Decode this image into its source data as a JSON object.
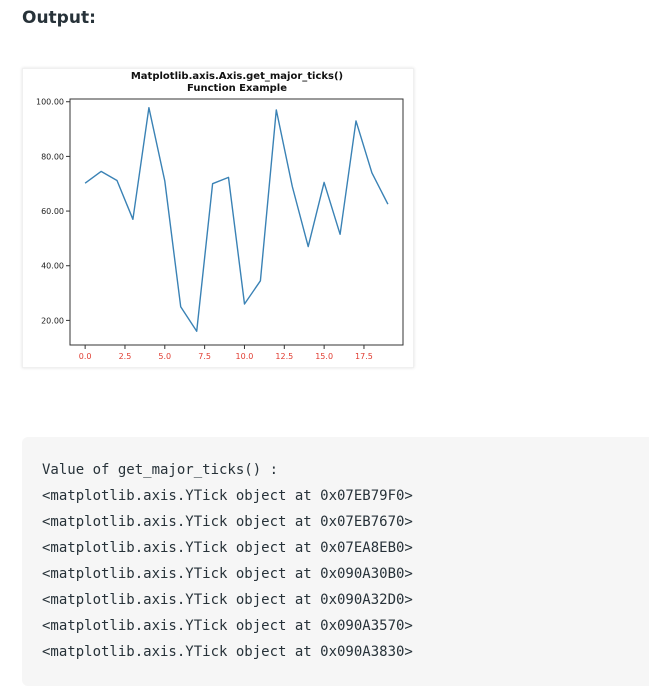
{
  "heading": "Output:",
  "colors": {
    "line": "#3a82b5",
    "xtick_label": "#e03c31",
    "ytick_label": "#222222",
    "axes_frame": "#333333"
  },
  "chart_data": {
    "type": "line",
    "title": "Matplotlib.axis.Axis.get_major_ticks()\nFunction Example",
    "title_lines": [
      "Matplotlib.axis.Axis.get_major_ticks()",
      "Function Example"
    ],
    "xlabel": "",
    "ylabel": "",
    "x": [
      0,
      1,
      2,
      3,
      4,
      5,
      6,
      7,
      8,
      9,
      10,
      11,
      12,
      13,
      14,
      15,
      16,
      17,
      18,
      19
    ],
    "series": [
      {
        "values": [
          70.2,
          74.5,
          71.2,
          57.0,
          97.8,
          71.0,
          25.0,
          16.0,
          70.0,
          72.3,
          26.0,
          34.5,
          97.0,
          69.0,
          47.0,
          70.5,
          51.5,
          93.0,
          74.0,
          62.5
        ]
      }
    ],
    "xlim": [
      -0.95,
      19.95
    ],
    "ylim": [
      11.0,
      101.0
    ],
    "xticks": [
      0.0,
      2.5,
      5.0,
      7.5,
      10.0,
      12.5,
      15.0,
      17.5
    ],
    "xtick_labels": [
      "0.0",
      "2.5",
      "5.0",
      "7.5",
      "10.0",
      "12.5",
      "15.0",
      "17.5"
    ],
    "yticks": [
      20,
      40,
      60,
      80,
      100
    ],
    "ytick_labels": [
      "20.00",
      "40.00",
      "60.00",
      "80.00",
      "100.00"
    ],
    "grid": false
  },
  "output": {
    "lines": [
      "Value of get_major_ticks() :",
      "<matplotlib.axis.YTick object at 0x07EB79F0>",
      "<matplotlib.axis.YTick object at 0x07EB7670>",
      "<matplotlib.axis.YTick object at 0x07EA8EB0>",
      "<matplotlib.axis.YTick object at 0x090A30B0>",
      "<matplotlib.axis.YTick object at 0x090A32D0>",
      "<matplotlib.axis.YTick object at 0x090A3570>",
      "<matplotlib.axis.YTick object at 0x090A3830>"
    ]
  }
}
